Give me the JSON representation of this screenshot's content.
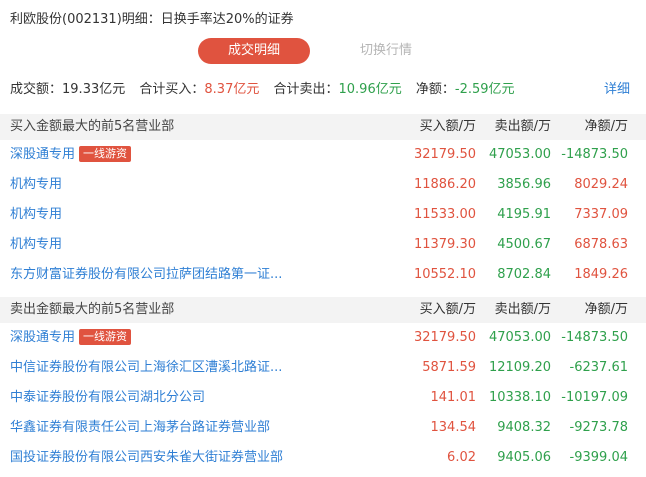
{
  "title": "利欧股份(002131)明细：日换手率达20%的证券",
  "tabs": {
    "active": "成交明细",
    "inactive": "切换行情"
  },
  "summary": {
    "turnover_label": "成交额：",
    "turnover_value": "19.33亿元",
    "buy_total_label": "合计买入：",
    "buy_total_value": "8.37亿元",
    "sell_total_label": "合计卖出：",
    "sell_total_value": "10.96亿元",
    "net_label": "净额：",
    "net_value": "-2.59亿元",
    "detail_link": "详细"
  },
  "buy_section": {
    "header": {
      "name": "买入金额最大的前5名营业部",
      "buy": "买入额/万",
      "sell": "卖出额/万",
      "net": "净额/万"
    },
    "rows": [
      {
        "name": "深股通专用",
        "badge": "一线游资",
        "buy": "32179.50",
        "sell": "47053.00",
        "net": "-14873.50"
      },
      {
        "name": "机构专用",
        "badge": "",
        "buy": "11886.20",
        "sell": "3856.96",
        "net": "8029.24"
      },
      {
        "name": "机构专用",
        "badge": "",
        "buy": "11533.00",
        "sell": "4195.91",
        "net": "7337.09"
      },
      {
        "name": "机构专用",
        "badge": "",
        "buy": "11379.30",
        "sell": "4500.67",
        "net": "6878.63"
      },
      {
        "name": "东方财富证券股份有限公司拉萨团结路第一证...",
        "badge": "",
        "buy": "10552.10",
        "sell": "8702.84",
        "net": "1849.26"
      }
    ]
  },
  "sell_section": {
    "header": {
      "name": "卖出金额最大的前5名营业部",
      "buy": "买入额/万",
      "sell": "卖出额/万",
      "net": "净额/万"
    },
    "rows": [
      {
        "name": "深股通专用",
        "badge": "一线游资",
        "buy": "32179.50",
        "sell": "47053.00",
        "net": "-14873.50"
      },
      {
        "name": "中信证券股份有限公司上海徐汇区漕溪北路证...",
        "badge": "",
        "buy": "5871.59",
        "sell": "12109.20",
        "net": "-6237.61"
      },
      {
        "name": "中泰证券股份有限公司湖北分公司",
        "badge": "",
        "buy": "141.01",
        "sell": "10338.10",
        "net": "-10197.09"
      },
      {
        "name": "华鑫证券有限责任公司上海茅台路证券营业部",
        "badge": "",
        "buy": "134.54",
        "sell": "9408.32",
        "net": "-9273.78"
      },
      {
        "name": "国投证券股份有限公司西安朱雀大街证券营业部",
        "badge": "",
        "buy": "6.02",
        "sell": "9405.06",
        "net": "-9399.04"
      }
    ]
  },
  "colors": {
    "up": "#e0533f",
    "down": "#2fa04c",
    "link": "#2f7fd4"
  }
}
